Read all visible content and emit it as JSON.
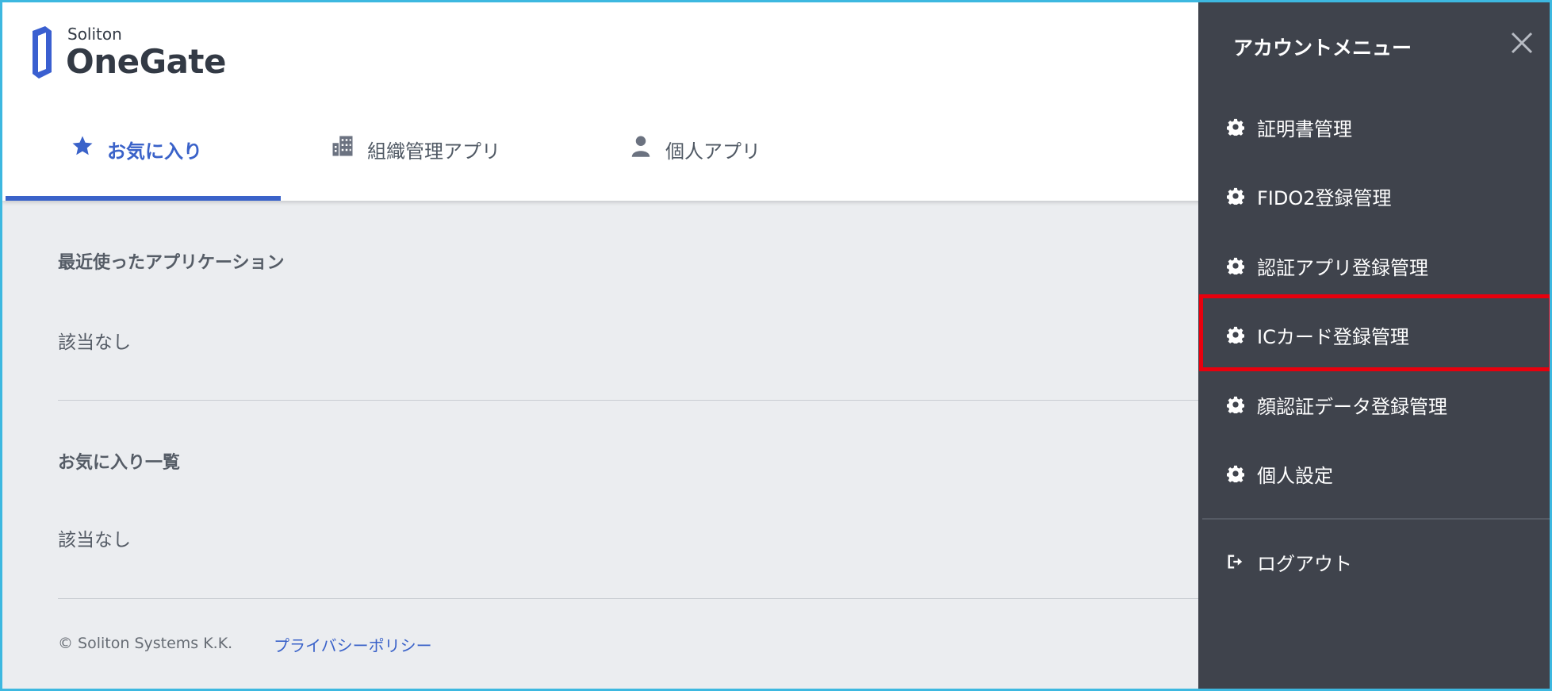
{
  "logo": {
    "small": "Soliton",
    "big": "OneGate"
  },
  "tabs": {
    "favorites": "お気に入り",
    "org_apps": "組織管理アプリ",
    "personal_apps": "個人アプリ"
  },
  "main": {
    "recent_title": "最近使ったアプリケーション",
    "recent_empty": "該当なし",
    "favorites_title": "お気に入り一覧",
    "favorites_empty": "該当なし"
  },
  "footer": {
    "copyright": "© Soliton Systems K.K.",
    "privacy": "プライバシーポリシー"
  },
  "menu": {
    "title": "アカウントメニュー",
    "items": [
      {
        "label": "証明書管理",
        "icon": "gear-icon"
      },
      {
        "label": "FIDO2登録管理",
        "icon": "gear-icon"
      },
      {
        "label": "認証アプリ登録管理",
        "icon": "gear-icon"
      },
      {
        "label": "ICカード登録管理",
        "icon": "gear-icon"
      },
      {
        "label": "顔認証データ登録管理",
        "icon": "gear-icon"
      },
      {
        "label": "個人設定",
        "icon": "gear-icon"
      }
    ],
    "logout": "ログアウト"
  },
  "colors": {
    "accent": "#3a62c9",
    "menu_bg": "#3f434c",
    "highlight": "#e8000d",
    "frame": "#3db8e0"
  }
}
